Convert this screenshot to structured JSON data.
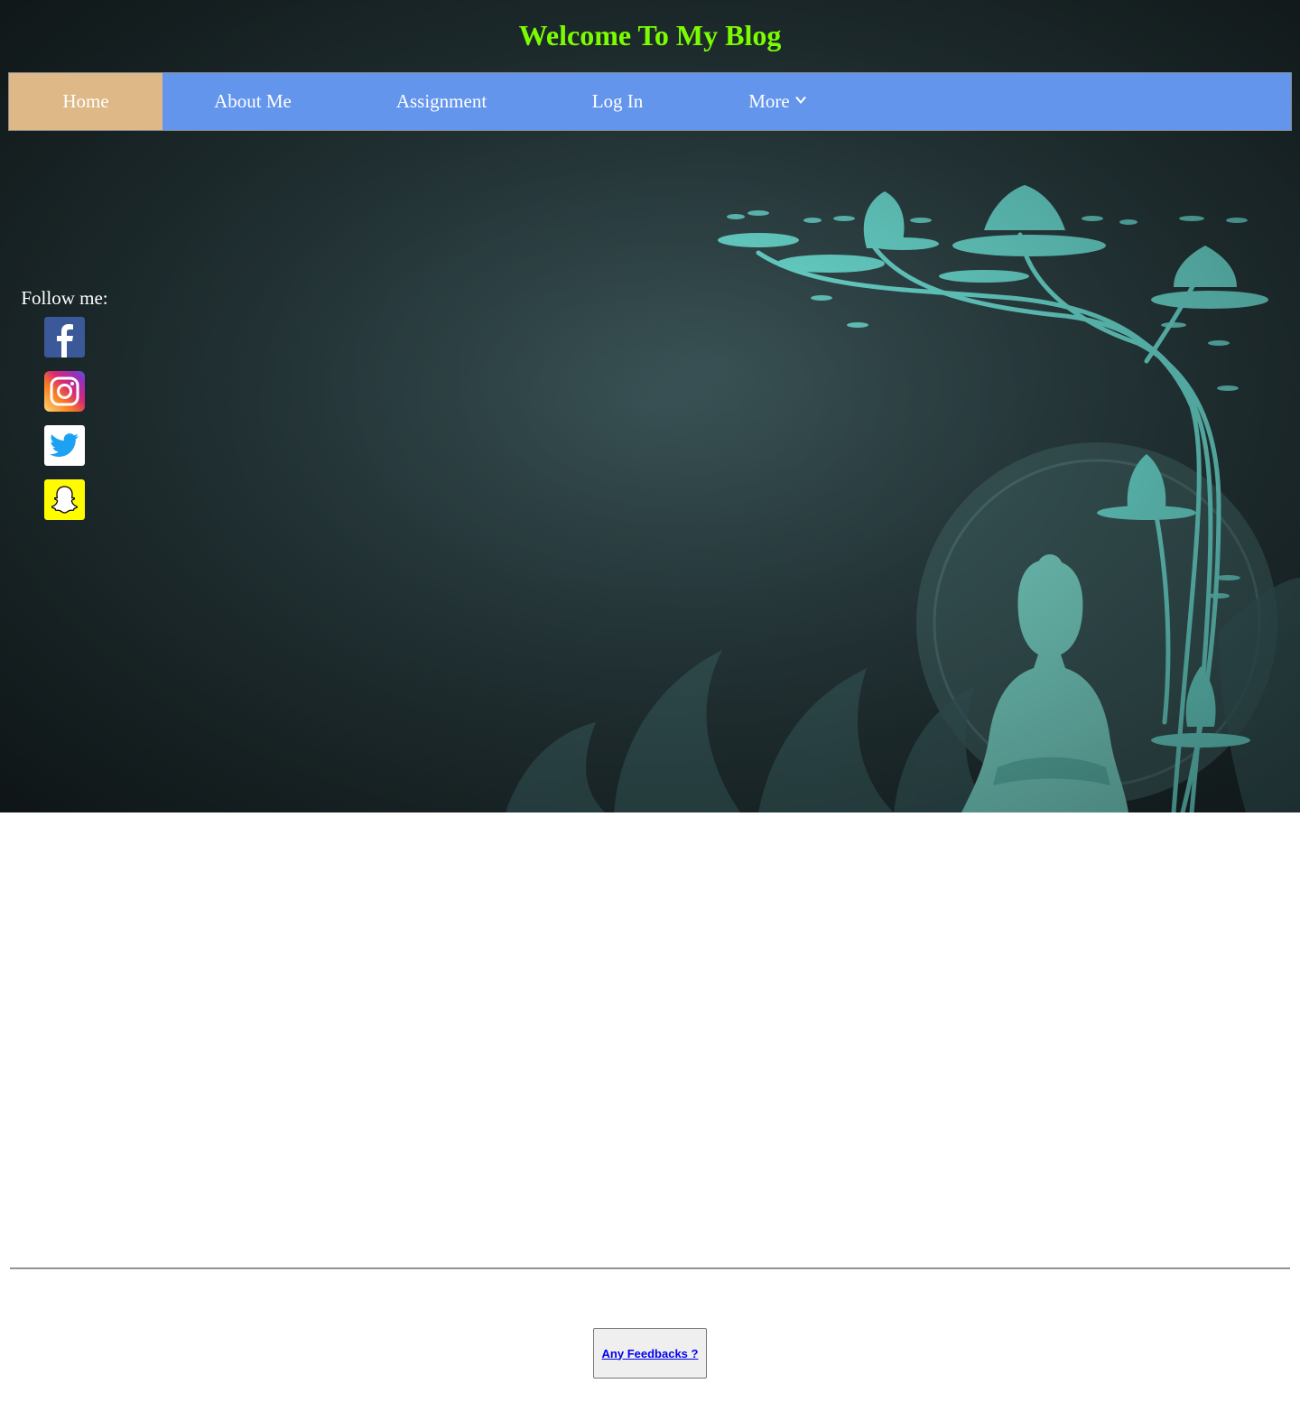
{
  "header": {
    "title": "Welcome To My Blog",
    "title_color": "#7cfc00"
  },
  "nav": {
    "background": "#6495ed",
    "active_background": "#deb887",
    "items": [
      {
        "label": "Home",
        "active": true
      },
      {
        "label": "About Me",
        "active": false
      },
      {
        "label": "Assignment",
        "active": false
      },
      {
        "label": "Log In",
        "active": false
      },
      {
        "label": "More",
        "active": false,
        "icon": "caret-down-icon"
      }
    ]
  },
  "sidebar": {
    "follow_label": "Follow me:",
    "social": [
      {
        "icon": "facebook-icon"
      },
      {
        "icon": "instagram-icon"
      },
      {
        "icon": "twitter-icon"
      },
      {
        "icon": "snapchat-icon"
      }
    ]
  },
  "hero": {
    "image": "buddha-lotus-background"
  },
  "footer": {
    "feedback_label": "Any Feedbacks ?"
  }
}
